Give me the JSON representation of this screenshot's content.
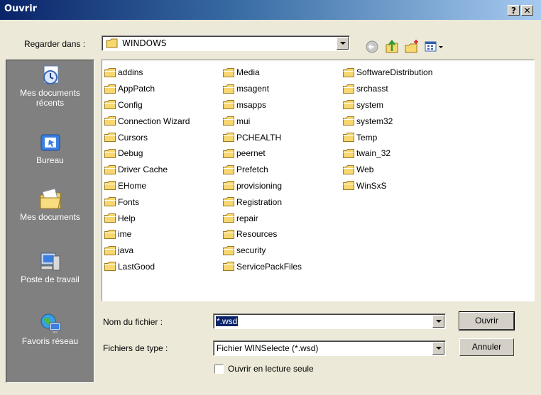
{
  "title": "Ouvrir",
  "titlebar": {
    "help_label": "?",
    "close_label": "✕"
  },
  "look_in": {
    "label": "Regarder dans :",
    "value": "WINDOWS"
  },
  "places": [
    {
      "label": "Mes documents récents",
      "icon": "recent-documents-icon"
    },
    {
      "label": "Bureau",
      "icon": "desktop-icon"
    },
    {
      "label": "Mes documents",
      "icon": "my-documents-icon"
    },
    {
      "label": "Poste de travail",
      "icon": "my-computer-icon"
    },
    {
      "label": "Favoris réseau",
      "icon": "network-places-icon"
    }
  ],
  "files": {
    "col1": [
      "addins",
      "AppPatch",
      "Config",
      "Connection Wizard",
      "Cursors",
      "Debug",
      "Driver Cache",
      "EHome",
      "Fonts",
      "Help",
      "ime",
      "java",
      "LastGood"
    ],
    "col2": [
      "Media",
      "msagent",
      "msapps",
      "mui",
      "PCHEALTH",
      "peernet",
      "Prefetch",
      "provisioning",
      "Registration",
      "repair",
      "Resources",
      "security",
      "ServicePackFiles"
    ],
    "col3": [
      "SoftwareDistribution",
      "srchasst",
      "system",
      "system32",
      "Temp",
      "twain_32",
      "Web",
      "WinSxS"
    ]
  },
  "filename": {
    "label": "Nom du fichier :",
    "value": "*.wsd"
  },
  "filetype": {
    "label": "Fichiers de type :",
    "value": "Fichier WINSelecte (*.wsd)"
  },
  "readonly": {
    "label": "Ouvrir en lecture seule",
    "checked": false
  },
  "buttons": {
    "open": "Ouvrir",
    "cancel": "Annuler"
  },
  "colors": {
    "title_start": "#0a246a",
    "title_end": "#a6caf0",
    "sidebar": "#808080",
    "dialog": "#ece9d8",
    "selection": "#0a246a"
  }
}
